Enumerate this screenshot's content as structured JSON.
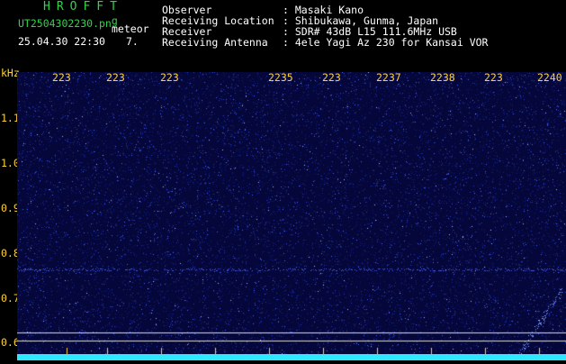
{
  "header": {
    "app_title": "HROFFT",
    "filename": "UT2504302230.pn",
    "filename_suffix": "g",
    "mode": "meteor",
    "date_time": "25.04.30 22:30",
    "count": "7.",
    "labels": {
      "observer": "Observer",
      "location": "Receiving Location",
      "receiver": "Receiver",
      "antenna": "Receiving Antenna"
    },
    "values": {
      "observer": ": Masaki Kano",
      "location": ": Shibukawa, Gunma, Japan",
      "receiver": ": SDR# 43dB L15 111.6MHz USB",
      "antenna": ": 4ele Yagi Az 230 for Kansai VOR"
    }
  },
  "y_axis": {
    "unit": "kHz",
    "ticks": [
      "1.1",
      "1.0",
      "0.9",
      "0.8",
      "0.7",
      "0.6"
    ]
  },
  "time_axis": {
    "labels": [
      "223",
      "223",
      "223",
      "2235",
      "223",
      "2237",
      "2238",
      "223",
      "2240"
    ]
  },
  "colors": {
    "background": "#000000",
    "plot_bg": "#05073a",
    "noise": "#2a3cc8",
    "header_green": "#2fd44a",
    "time_label": "#ffd23a",
    "axis_label": "#ffd23a",
    "baseline": "#2ee8ff",
    "guide_line": "#d8d8d8"
  }
}
